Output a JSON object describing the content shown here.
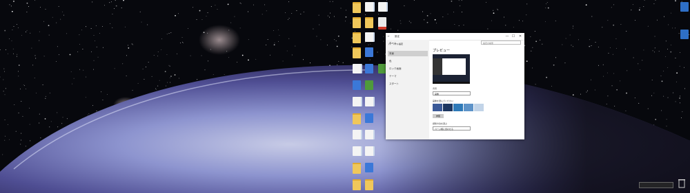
{
  "desktop": {
    "icons": [
      {
        "label": "",
        "type": "folder"
      },
      {
        "label": "",
        "type": "doc"
      },
      {
        "label": "",
        "type": "doc"
      },
      {
        "label": "",
        "type": "folder"
      },
      {
        "label": "",
        "type": "folder"
      },
      {
        "label": "",
        "type": "red"
      },
      {
        "label": "",
        "type": "folder"
      },
      {
        "label": "",
        "type": "doc"
      },
      {
        "label": "",
        "type": "folder"
      },
      {
        "label": "",
        "type": "app"
      },
      {
        "label": "",
        "type": "doc"
      },
      {
        "label": "",
        "type": "app"
      },
      {
        "label": "",
        "type": "green"
      },
      {
        "label": "",
        "type": "app"
      },
      {
        "label": "",
        "type": "green"
      },
      {
        "label": "",
        "type": "doc"
      },
      {
        "label": "",
        "type": "doc"
      },
      {
        "label": "",
        "type": "folder"
      },
      {
        "label": "",
        "type": "app"
      },
      {
        "label": "",
        "type": "doc"
      },
      {
        "label": "",
        "type": "doc"
      },
      {
        "label": "",
        "type": "doc"
      },
      {
        "label": "",
        "type": "doc"
      },
      {
        "label": "",
        "type": "folder"
      },
      {
        "label": "",
        "type": "app"
      },
      {
        "label": "",
        "type": "folder"
      },
      {
        "label": "",
        "type": "pc"
      },
      {
        "label": "",
        "type": "folder"
      },
      {
        "label": "",
        "type": "pc"
      }
    ],
    "trash_label": "",
    "keyboard_bar": ""
  },
  "settings": {
    "app": "設定",
    "title": "パーソナル設定",
    "home": "ホーム",
    "search_placeholder": "設定の検索",
    "nav": [
      "背景",
      "色",
      "ロック画面",
      "テーマ",
      "スタート"
    ],
    "page_heading": "プレビュー",
    "background_label": "背景",
    "background_value": "画像",
    "choose_picture_label": "画像を選んでください",
    "browse_button": "参照",
    "fit_label": "調整方法を選ぶ",
    "fit_value": "ページ幅に合わせる",
    "buttons": {
      "min": "—",
      "max": "☐",
      "close": "✕"
    }
  },
  "colors": {
    "accent": "#0078d7",
    "window_bg": "#ffffff",
    "nav_bg": "#f2f2f2"
  }
}
